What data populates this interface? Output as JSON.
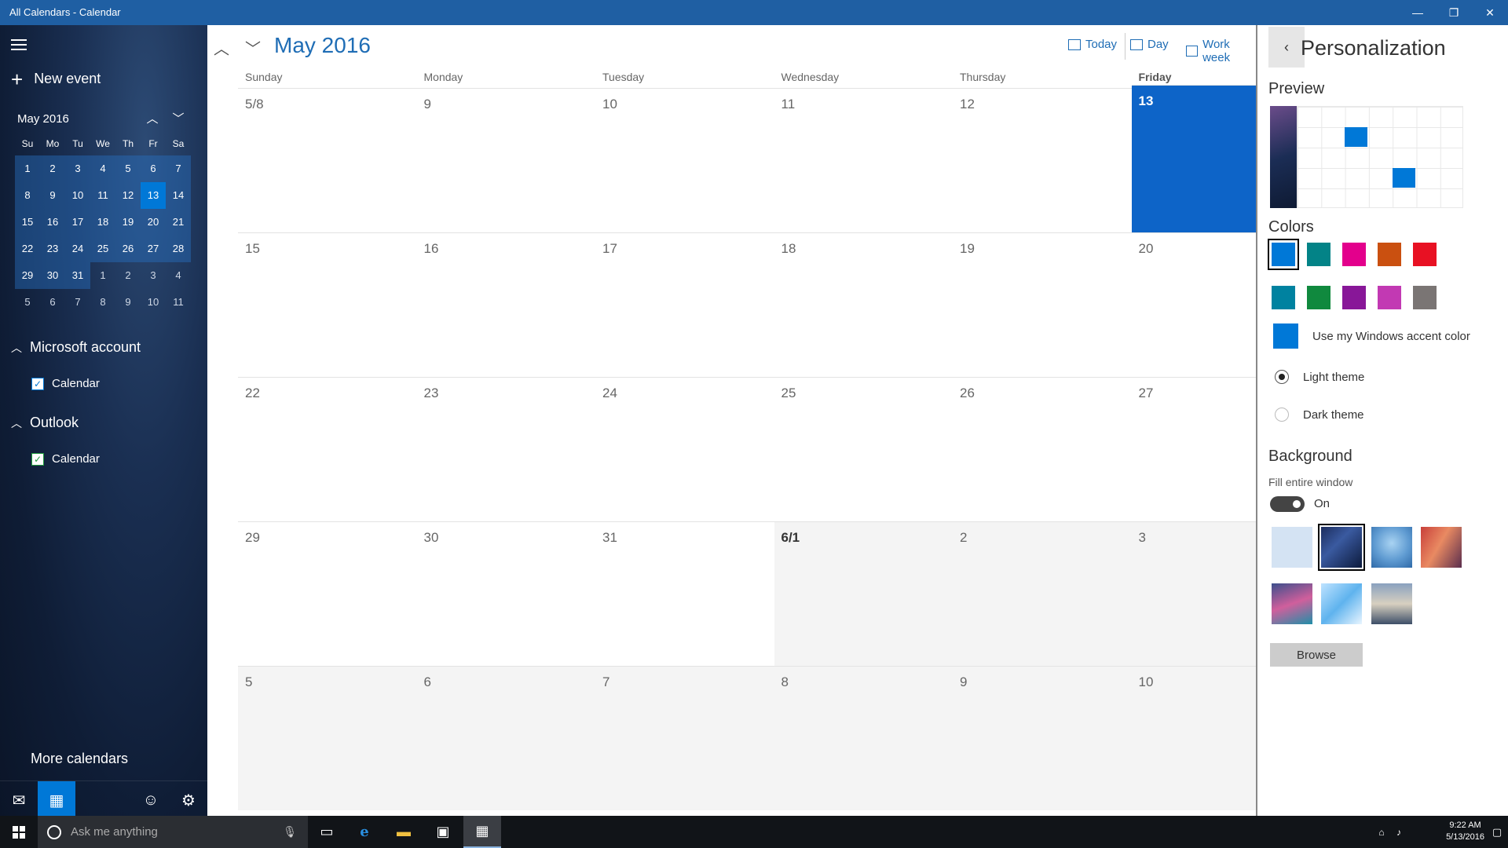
{
  "window": {
    "title": "All Calendars - Calendar",
    "controls": {
      "minimize": "—",
      "restore": "❐",
      "close": "✕"
    }
  },
  "sidebar": {
    "new_event": "New event",
    "mini_cal": {
      "title": "May 2016",
      "dow": [
        "Su",
        "Mo",
        "Tu",
        "We",
        "Th",
        "Fr",
        "Sa"
      ],
      "days": [
        "1",
        "2",
        "3",
        "4",
        "5",
        "6",
        "7",
        "8",
        "9",
        "10",
        "11",
        "12",
        "13",
        "14",
        "15",
        "16",
        "17",
        "18",
        "19",
        "20",
        "21",
        "22",
        "23",
        "24",
        "25",
        "26",
        "27",
        "28",
        "29",
        "30",
        "31",
        "1",
        "2",
        "3",
        "4",
        "5",
        "6",
        "7",
        "8",
        "9",
        "10",
        "11"
      ],
      "selected": "13"
    },
    "accounts": [
      {
        "name": "Microsoft account",
        "calendar": "Calendar",
        "check_color": "#0078d7"
      },
      {
        "name": "Outlook",
        "calendar": "Calendar",
        "check_color": "#1e9b3c"
      }
    ],
    "more_calendars": "More calendars",
    "bottom": {
      "mail_icon": "mail-icon",
      "calendar_icon": "calendar-icon",
      "feedback_icon": "smiley-icon",
      "settings_icon": "gear-icon"
    }
  },
  "calendar": {
    "month_title": "May 2016",
    "views": {
      "today": "Today",
      "day": "Day",
      "work_week": "Work week"
    },
    "dow": [
      "Sunday",
      "Monday",
      "Tuesday",
      "Wednesday",
      "Thursday",
      "Friday"
    ],
    "weeks": [
      [
        "5/8",
        "9",
        "10",
        "11",
        "12",
        "13"
      ],
      [
        "15",
        "16",
        "17",
        "18",
        "19",
        "20"
      ],
      [
        "22",
        "23",
        "24",
        "25",
        "26",
        "27"
      ],
      [
        "29",
        "30",
        "31",
        "6/1",
        "2",
        "3"
      ],
      [
        "5",
        "6",
        "7",
        "8",
        "9",
        "10"
      ]
    ],
    "today": "13",
    "accent": "#0d64c8"
  },
  "personalization": {
    "title": "Personalization",
    "preview_heading": "Preview",
    "colors_heading": "Colors",
    "colors": [
      "#0078d7",
      "#038387",
      "#e3008c",
      "#ca5010",
      "#e81123",
      "#0082a0",
      "#10893e",
      "#881798",
      "#c239b3",
      "#7a7574"
    ],
    "selected_color": "#0078d7",
    "accent_label": "Use my Windows accent color",
    "light_theme": "Light theme",
    "dark_theme": "Dark theme",
    "theme_selected": "light",
    "background_heading": "Background",
    "fill_label": "Fill entire window",
    "fill_state": "On",
    "browse": "Browse"
  },
  "taskbar": {
    "search_placeholder": "Ask me anything",
    "time": "9:22 AM",
    "date": "5/13/2016"
  }
}
